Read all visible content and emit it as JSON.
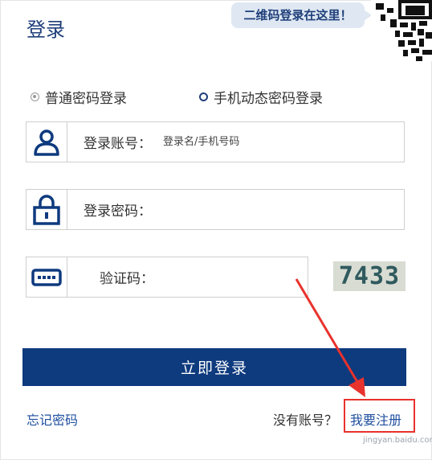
{
  "header": {
    "title": "登录",
    "qr_hint": "二维码登录在这里！"
  },
  "login_mode": {
    "options": [
      {
        "label": "普通密码登录",
        "checked": true
      },
      {
        "label": "手机动态密码登录",
        "checked": false
      }
    ]
  },
  "fields": {
    "username": {
      "label": "登录账号：",
      "placeholder": "登录名/手机号码",
      "icon": "user-icon"
    },
    "password": {
      "label": "登录密码：",
      "placeholder": "",
      "icon": "lock-icon"
    },
    "captcha": {
      "label": "验证码：",
      "placeholder": "",
      "icon": "keyboard-icon",
      "image_text": "7433"
    }
  },
  "actions": {
    "login_button": "立即登录",
    "forgot_password": "忘记密码",
    "no_account": "没有账号？",
    "register": "我要注册"
  },
  "annotation": {
    "highlight_color": "#e8322d"
  },
  "watermark": "jingyan.baidu.com",
  "colors": {
    "brand_navy": "#0e3a7e",
    "link_blue": "#1f4f9f"
  }
}
